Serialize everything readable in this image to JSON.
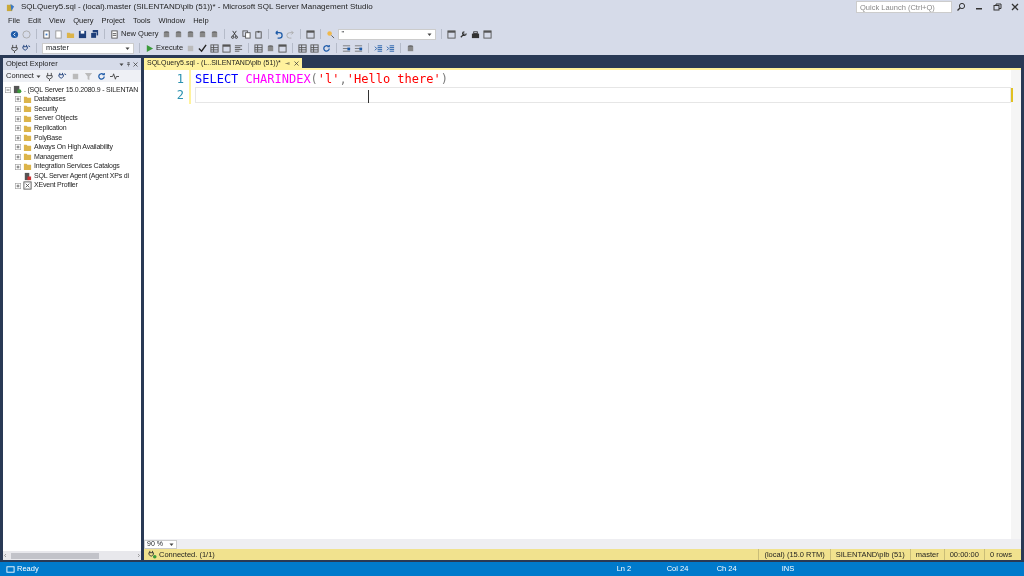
{
  "window": {
    "title": "SQLQuery5.sql - (local).master (SILENTAND\\plb (51))* - Microsoft SQL Server Management Studio"
  },
  "quick_launch": {
    "placeholder": "Quick Launch (Ctrl+Q)"
  },
  "menu": [
    "File",
    "Edit",
    "View",
    "Query",
    "Project",
    "Tools",
    "Window",
    "Help"
  ],
  "toolbar": {
    "new_query": "New Query",
    "search_value": "\"",
    "database": "master",
    "execute": "Execute"
  },
  "object_explorer": {
    "title": "Object Explorer",
    "connect": "Connect",
    "tree": [
      {
        "label": ". (SQL Server 15.0.2080.9 - SILENTAN",
        "kind": "server",
        "expanded": true,
        "children": [
          {
            "label": "Databases",
            "kind": "folder",
            "expanded": false
          },
          {
            "label": "Security",
            "kind": "folder",
            "expanded": false
          },
          {
            "label": "Server Objects",
            "kind": "folder",
            "expanded": false
          },
          {
            "label": "Replication",
            "kind": "folder",
            "expanded": false
          },
          {
            "label": "PolyBase",
            "kind": "folder",
            "expanded": false
          },
          {
            "label": "Always On High Availability",
            "kind": "folder",
            "expanded": false
          },
          {
            "label": "Management",
            "kind": "folder",
            "expanded": false
          },
          {
            "label": "Integration Services Catalogs",
            "kind": "folder",
            "expanded": false
          },
          {
            "label": "SQL Server Agent (Agent XPs di",
            "kind": "agent"
          },
          {
            "label": "XEvent Profiler",
            "kind": "profiler",
            "expanded": false
          }
        ]
      }
    ]
  },
  "tabs": [
    {
      "label": "SQLQuery5.sql - (L..SILENTAND\\plb (51))*",
      "selected": true
    }
  ],
  "editor": {
    "lines": [
      {
        "number": "1",
        "tokens": [
          {
            "text": "SELECT",
            "kind": "keyword",
            "space_after": true
          },
          {
            "text": "CHARINDEX",
            "kind": "function"
          },
          {
            "text": "(",
            "kind": "punct"
          },
          {
            "text": "'l'",
            "kind": "string"
          },
          {
            "text": ",",
            "kind": "punct"
          },
          {
            "text": "'Hello there'",
            "kind": "string"
          },
          {
            "text": ")",
            "kind": "punct"
          }
        ]
      },
      {
        "number": "2",
        "current": true
      }
    ],
    "zoom": "90 %"
  },
  "connection_bar": {
    "status": "Connected. (1/1)",
    "segments": [
      "(local) (15.0 RTM)",
      "SILENTAND\\plb (51)",
      "master",
      "00:00:00",
      "0 rows"
    ]
  },
  "status_bar": {
    "state": "Ready",
    "items": [
      "Ln 2",
      "Col 24",
      "Ch 24",
      "INS"
    ]
  }
}
